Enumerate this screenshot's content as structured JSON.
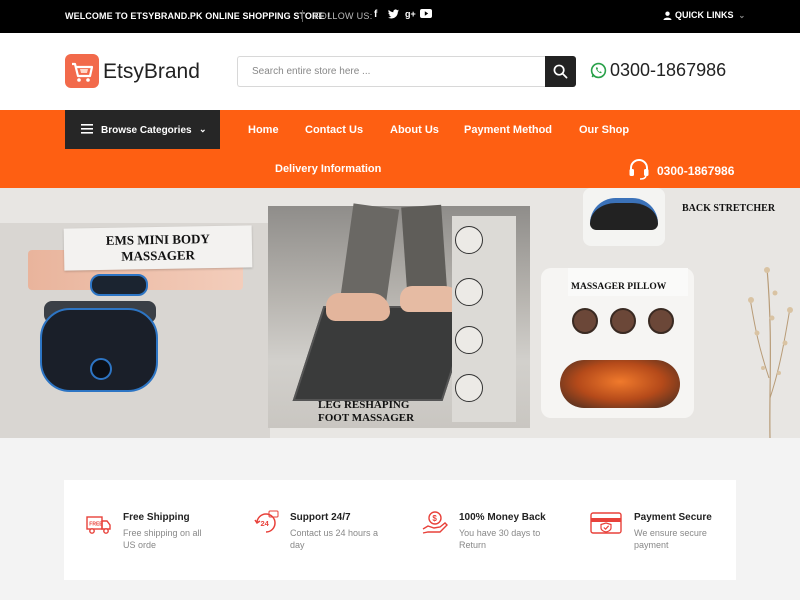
{
  "topbar": {
    "welcome": "WELCOME TO ETSYBRAND.PK ONLINE SHOPPING STORE !",
    "follow_label": "FOLLOW US:",
    "social": [
      {
        "name": "facebook-icon",
        "glyph": "f"
      },
      {
        "name": "twitter-icon",
        "glyph": "t"
      },
      {
        "name": "google-plus-icon",
        "glyph": "g+"
      },
      {
        "name": "youtube-icon",
        "glyph": "▶"
      }
    ],
    "quick_links": "QUICK LINKS"
  },
  "header": {
    "logo_text": "EtsyBrand",
    "search_placeholder": "Search entire store here ...",
    "phone": "0300-1867986"
  },
  "nav": {
    "browse_label": "Browse Categories",
    "links": [
      "Home",
      "Contact Us",
      "About Us",
      "Payment Method",
      "Our Shop",
      "Delivery Information"
    ],
    "phone": "0300-1867986"
  },
  "banner": {
    "ems_label": [
      "EMS MINI BODY",
      "MASSAGER"
    ],
    "leg_label": [
      "LEG RESHAPING",
      "FOOT MASSAGER"
    ],
    "back_label": "BACK STRETCHER",
    "pillow_label": "MASSAGER PILLOW"
  },
  "features": [
    {
      "title": "Free Shipping",
      "desc": [
        "Free shipping on all",
        "US orde"
      ],
      "icon": "truck-icon"
    },
    {
      "title": "Support 24/7",
      "desc": [
        "Contact us 24 hours a",
        "day"
      ],
      "icon": "support-24-icon"
    },
    {
      "title": "100% Money Back",
      "desc": [
        "You have 30 days to",
        "Return"
      ],
      "icon": "money-back-icon"
    },
    {
      "title": "Payment Secure",
      "desc": [
        "We ensure secure",
        "payment"
      ],
      "icon": "secure-payment-icon"
    }
  ],
  "colors": {
    "accent": "#fe5f12",
    "topbar": "#000000",
    "browse_bg": "#262626",
    "icon_red": "#e8413a"
  }
}
